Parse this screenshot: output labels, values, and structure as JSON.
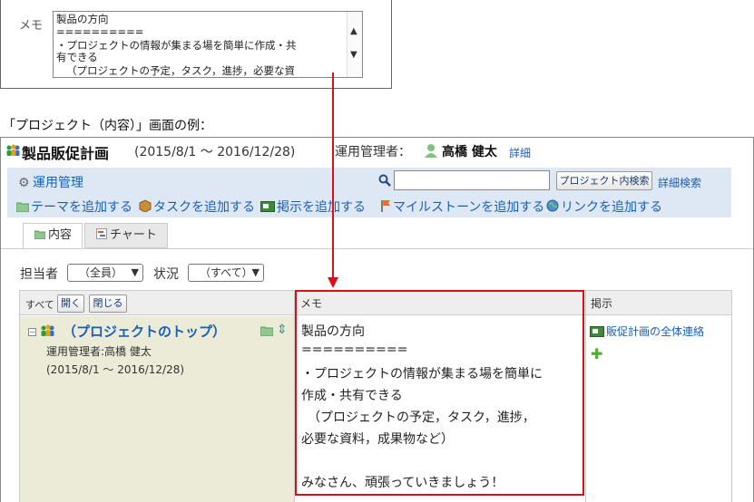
{
  "memo_field": {
    "label": "メモ",
    "lines": [
      "製品の方向",
      "==========",
      "・プロジェクトの情報が集まる場を簡単に作成・共",
      "有できる",
      "（プロジェクトの予定，タスク，進捗，必要な資"
    ]
  },
  "caption": "「プロジェクト（内容）」画面の例：",
  "header": {
    "project_name": "製品販促計画",
    "dates": "(2015/8/1 ～ 2016/12/28)",
    "admin_label": "運用管理者：",
    "admin_name": "高橋 健太",
    "detail_link": "詳細"
  },
  "toolbar": {
    "management": "運用管理",
    "search_button": "プロジェクト内検索",
    "advanced_search": "詳細検索",
    "actions": [
      "テーマを追加する",
      "タスクを追加する",
      "掲示を追加する",
      "マイルストーンを追加する",
      "リンクを追加する"
    ]
  },
  "tabs": {
    "content": "内容",
    "chart": "チャート"
  },
  "filters": {
    "assignee_label": "担当者",
    "assignee_value": "（全員）",
    "status_label": "状況",
    "status_value": "（すべて）"
  },
  "table": {
    "all_label": "すべて",
    "open_button": "開く",
    "close_button": "閉じる",
    "memo_header": "メモ",
    "board_header": "掲示",
    "tree": {
      "title": "（プロジェクトのトップ）",
      "admin": "運用管理者:高橋 健太",
      "dates": "(2015/8/1 ～ 2016/12/28)"
    },
    "memo_lines": [
      "製品の方向",
      "==========",
      "・プロジェクトの情報が集まる場を簡単に",
      "作成・共有できる",
      "（プロジェクトの予定，タスク，進捗，",
      "必要な資料，成果物など）",
      "",
      "みなさん、頑張っていきましょう！"
    ],
    "board_link": "販促計画の全体連絡"
  },
  "colors": {
    "accent_link": "#1a5fb4",
    "highlight": "#d8101b",
    "toolbar_bg": "#dde8f4",
    "tree_bg": "#ebebd7"
  }
}
